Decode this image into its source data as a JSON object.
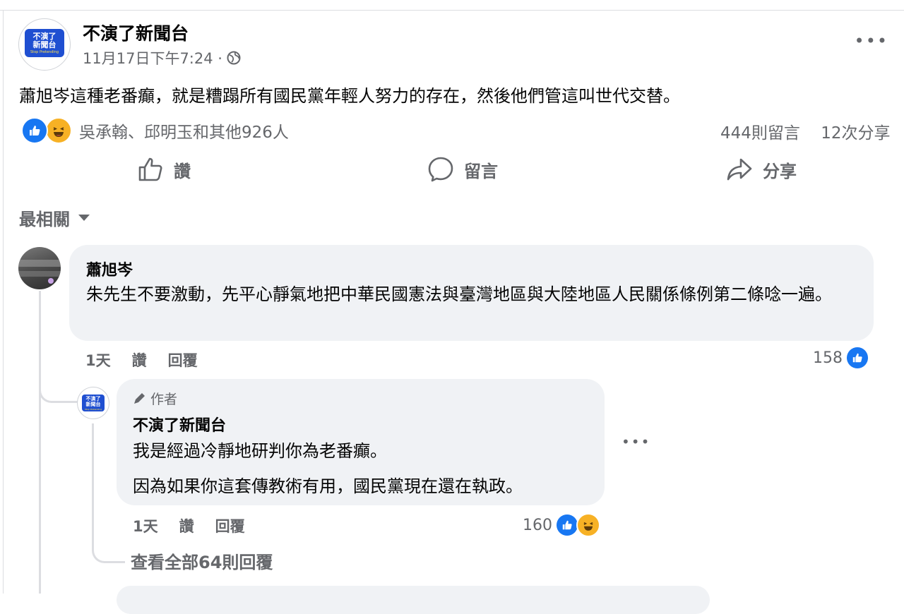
{
  "post": {
    "page_name": "不演了新聞台",
    "timestamp": "11月17日下午7:24 ·",
    "privacy_icon": "globe-icon",
    "logo_text": "不演了\n新聞台",
    "logo_sub": "Stop Pretending",
    "text": "蕭旭岑這種老番癲，就是糟蹋所有國民黨年輕人努力的存在，然後他們管這叫世代交替。",
    "reactions_names": "吳承翰、邱明玉和其他926人",
    "comments_count": "444則留言",
    "shares_count": "12次分享",
    "reaction_icons": [
      "like-icon",
      "haha-icon"
    ]
  },
  "actions": {
    "like": "讚",
    "comment": "留言",
    "share": "分享"
  },
  "sort": {
    "label": "最相關"
  },
  "comments": [
    {
      "name": "蕭旭岑",
      "text": "朱先生不要激動，先平心靜氣地把中華民國憲法與臺灣地區與大陸地區人民關係條例第二條唸一遍。",
      "time": "1天",
      "like": "讚",
      "reply": "回覆",
      "reaction_count": "158"
    }
  ],
  "reply": {
    "badge": "作者",
    "name": "不演了新聞台",
    "line1": "我是經過冷靜地研判你為老番癲。",
    "line2": "因為如果你這套傳教術有用，國民黨現在還在執政。",
    "time": "1天",
    "like": "讚",
    "reply": "回覆",
    "reaction_count": "160"
  },
  "view_all_replies": "查看全部64則回覆",
  "colors": {
    "brand_blue": "#1877f2",
    "haha_yellow": "#f7b125",
    "secondary_text": "#65676b",
    "bubble_bg": "#f0f2f5"
  }
}
